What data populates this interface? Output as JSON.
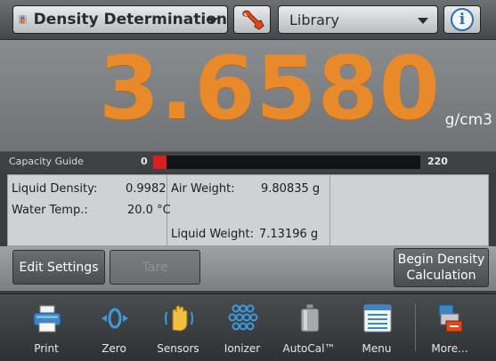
{
  "topbar": {
    "application": "Density Determination",
    "library": "Library"
  },
  "reading": {
    "value": "3.6580",
    "unit": "g/cm3",
    "color": "#e8892a"
  },
  "capacity": {
    "label": "Capacity Guide",
    "min": "0",
    "max": "220",
    "fill_fraction": 0.05,
    "fill_color": "#d81e1e"
  },
  "data": {
    "liquid_density_label": "Liquid Density:",
    "liquid_density_value": "0.9982",
    "water_temp_label": "Water Temp.:",
    "water_temp_value": "20.0 °C",
    "air_weight_label": "Air Weight:",
    "air_weight_value": "9.80835 g",
    "liquid_weight_label": "Liquid Weight:",
    "liquid_weight_value": "7.13196 g"
  },
  "actions": {
    "edit_settings": "Edit Settings",
    "tare": "Tare",
    "begin_line1": "Begin Density",
    "begin_line2": "Calculation"
  },
  "toolbar": {
    "print": "Print",
    "zero": "Zero",
    "sensors": "Sensors",
    "ionizer": "Ionizer",
    "autocal": "AutoCal™",
    "menu": "Menu",
    "more": "More..."
  },
  "icons": {
    "app": "density-beaker-icon",
    "wrench": "wrench-icon",
    "info": "info-icon",
    "print": "printer-icon",
    "zero": "zero-icon",
    "sensors": "hand-sensor-icon",
    "ionizer": "ionizer-icon",
    "autocal": "weight-cylinder-icon",
    "menu": "menu-list-icon",
    "more": "more-icon"
  }
}
